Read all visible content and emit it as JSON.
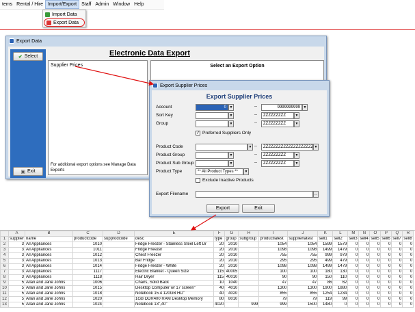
{
  "menubar": {
    "items": [
      "tems",
      "Rental / Hire",
      "Import/Export",
      "Staff",
      "Admin",
      "Window",
      "Help"
    ],
    "dropdown": [
      "Import Data",
      "Export Data"
    ]
  },
  "export_data_window": {
    "title": "Export Data",
    "heading": "Electronic Data Export",
    "select_label": "Select",
    "exit_label": "Exit",
    "list_item": "Supplier Prices",
    "footer_note": "For additional export options see Manage Data Exports",
    "right_heading": "Select an Export Option"
  },
  "supplier_prices_window": {
    "title": "Export Supplier Prices",
    "heading": "Export Supplier Prices",
    "account_label": "Account",
    "account_from": "0",
    "account_to": "9999999999",
    "sortkey_label": "Sort Key",
    "sortkey_to": "ZZZZZZZZZ",
    "group_label": "Group",
    "group_to": "ZZZZZZZZZ",
    "preferred_label": "Preferred Suppliers Only",
    "product_code_label": "Product Code",
    "product_code_to": "ZZZZZZZZZZZZZZZZZZZZ",
    "product_group_label": "Product Group",
    "product_group_to": "ZZZZZZZZZ",
    "product_subgroup_label": "Product Sub Group",
    "product_subgroup_to": "ZZZZZZZZZ",
    "product_type_label": "Product Type",
    "product_type_value": "** All Product Types **",
    "exclude_label": "Exclude Inactive Products",
    "filename_label": "Export Filename",
    "export_btn": "Export",
    "exit_btn": "Exit",
    "dash": "--"
  },
  "sheet": {
    "col_letters": [
      "",
      "A",
      "B",
      "C",
      "D",
      "E",
      "F",
      "G",
      "H",
      "I",
      "J",
      "K",
      "L",
      "M",
      "N",
      "O",
      "P",
      "Q",
      "R"
    ],
    "rows": [
      [
        "1",
        "supplier",
        "name",
        "productcode",
        "supprodcode",
        "desc",
        "type",
        "group",
        "subgroup",
        "productlatest",
        "supplierlatest",
        "sell1",
        "sell2",
        "sell3",
        "sell4",
        "sell5",
        "sell6",
        "sell7",
        "sell8"
      ],
      [
        "2",
        "3",
        "All Appliances",
        "1010",
        "",
        "Fridge Freezer - Stainless Steel Left Dr",
        "20",
        "2010",
        "",
        "1054",
        "1054",
        "1599",
        "1579",
        "0",
        "0",
        "0",
        "0",
        "0",
        "0"
      ],
      [
        "3",
        "3",
        "All Appliances",
        "1011",
        "",
        "Fridge Freezer",
        "20",
        "2010",
        "",
        "1098",
        "1098",
        "1499",
        "1479",
        "0",
        "0",
        "0",
        "0",
        "0",
        "0"
      ],
      [
        "4",
        "3",
        "All Appliances",
        "1012",
        "",
        "Chest Freezer",
        "20",
        "2010",
        "",
        "755",
        "755",
        "999",
        "979",
        "0",
        "0",
        "0",
        "0",
        "0",
        "0"
      ],
      [
        "5",
        "3",
        "All Appliances",
        "1013",
        "",
        "Bar Fridge",
        "20",
        "2010",
        "",
        "295",
        "295",
        "499",
        "479",
        "0",
        "0",
        "0",
        "0",
        "0",
        "0"
      ],
      [
        "6",
        "3",
        "All Appliances",
        "1014",
        "",
        "Fridge Freezer - White",
        "20",
        "2010",
        "",
        "1098",
        "1098",
        "1499",
        "1479",
        "0",
        "0",
        "0",
        "0",
        "0",
        "0"
      ],
      [
        "7",
        "3",
        "All Appliances",
        "1117",
        "",
        "Electric Blanket - Queen Size",
        "115",
        "40005",
        "",
        "100",
        "100",
        "180",
        "130",
        "0",
        "0",
        "0",
        "0",
        "0",
        "0"
      ],
      [
        "8",
        "3",
        "All Appliances",
        "1118",
        "",
        "Hair Dryer",
        "115",
        "40010",
        "",
        "90",
        "90",
        "150",
        "110",
        "0",
        "0",
        "0",
        "0",
        "0",
        "0"
      ],
      [
        "9",
        "5",
        "Allan and Jane Johns",
        "1006",
        "",
        "Chairs, Solid Back",
        "10",
        "1040",
        "",
        "47",
        "47",
        "86",
        "62",
        "0",
        "0",
        "0",
        "0",
        "0",
        "0"
      ],
      [
        "10",
        "5",
        "Allan and Jane Johns",
        "1015",
        "",
        "Desktop Computer w/ 17 screen\"",
        "40",
        "4010",
        "",
        "1300",
        "1300",
        "1900",
        "1880",
        "0",
        "0",
        "0",
        "0",
        "0",
        "0"
      ],
      [
        "11",
        "5",
        "Allan and Jane Johns",
        "1018",
        "",
        "Notebook 15.4 120GB HD\"",
        "40",
        "4020",
        "",
        "855",
        "855",
        "1254",
        "1234",
        "0",
        "0",
        "0",
        "0",
        "0",
        "0"
      ],
      [
        "12",
        "5",
        "Allan and Jane Johns",
        "1020",
        "",
        "1GB DDR400 RAM Desktop Memory",
        "80",
        "8010",
        "",
        "79",
        "79",
        "119",
        "99",
        "0",
        "0",
        "0",
        "0",
        "0",
        "0"
      ],
      [
        "13",
        "5",
        "Allan and Jane Johns",
        "1024",
        "",
        "Notebook 13\",40\"",
        "4020",
        "",
        "999",
        "999",
        "1500",
        "1480",
        "0",
        "0",
        "0",
        "0",
        "0",
        "0",
        "0"
      ]
    ]
  }
}
